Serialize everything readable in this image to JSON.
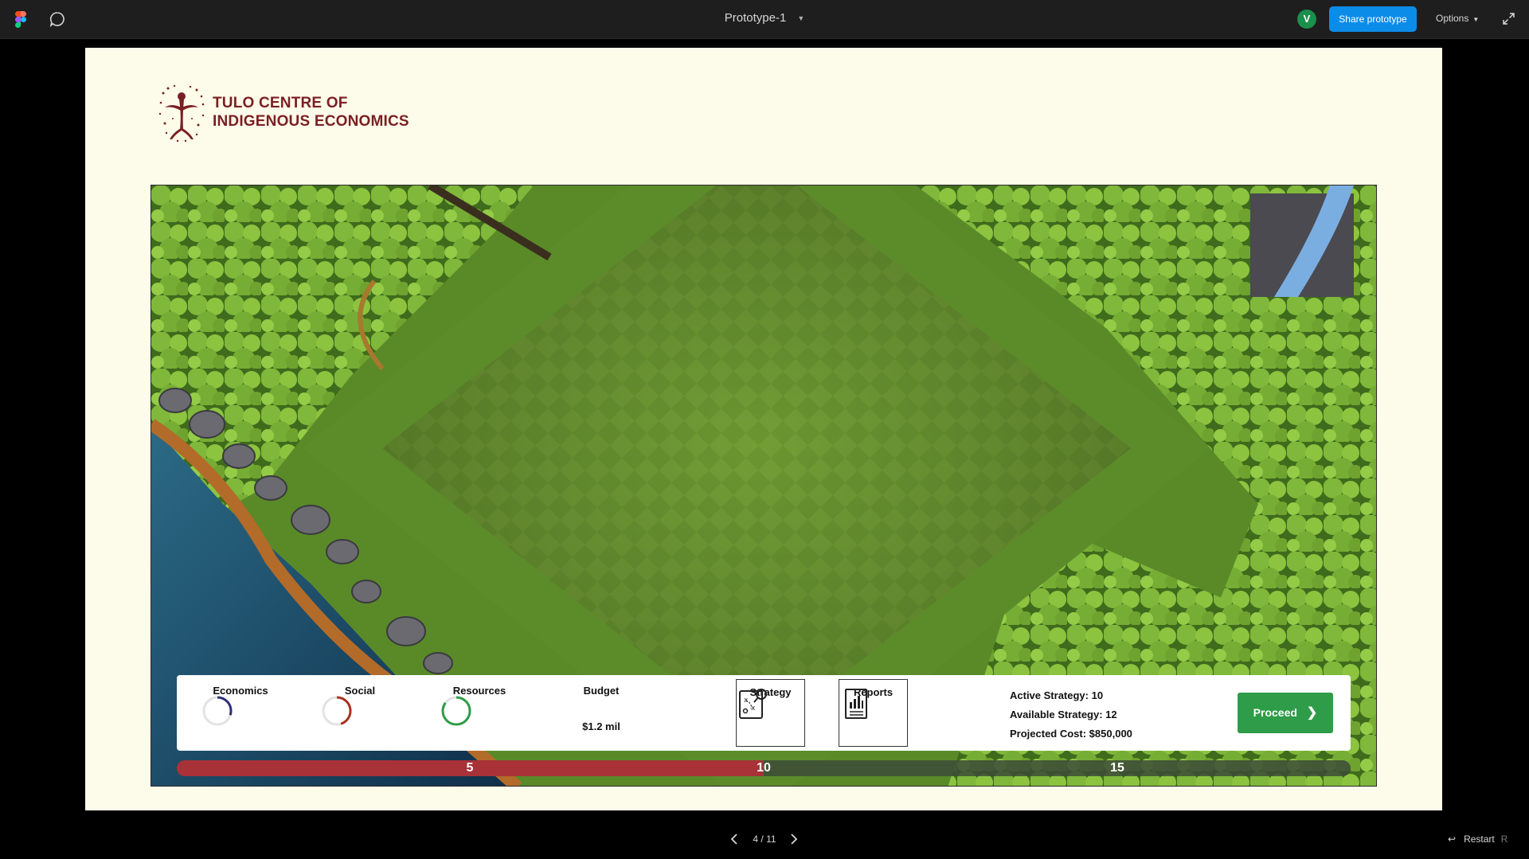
{
  "toolbar": {
    "title": "Prototype-1",
    "avatar_initial": "V",
    "share_label": "Share prototype",
    "options_label": "Options",
    "icons": [
      "figma-logo",
      "comment-icon",
      "chevron-down-icon",
      "expand-icon"
    ]
  },
  "brand": {
    "line1": "TULO CENTRE OF",
    "line2": "INDIGENOUS ECONOMICS",
    "color": "#7a1f24"
  },
  "hud": {
    "metrics": [
      {
        "label": "Economics",
        "gauge_fraction": 0.3,
        "color": "#2b2f7a"
      },
      {
        "label": "Social",
        "gauge_fraction": 0.45,
        "color": "#a8321f"
      },
      {
        "label": "Resources",
        "gauge_fraction": 0.85,
        "color": "#2e9c48"
      }
    ],
    "budget_label": "Budget",
    "budget_value": "$1.2 mil",
    "strategy_label": "Strategy",
    "reports_label": "Reports",
    "active_strategy": "Active Strategy: 10",
    "available_strategy": "Available Strategy: 12",
    "projected_cost": "Projected Cost: $850,000",
    "proceed_label": "Proceed"
  },
  "progress": {
    "fill_fraction": 0.5,
    "milestones": [
      "5",
      "10",
      "15"
    ],
    "fill_color": "#a83238"
  },
  "nav": {
    "page": "4 / 11",
    "restart_label": "Restart",
    "restart_key": "R"
  }
}
